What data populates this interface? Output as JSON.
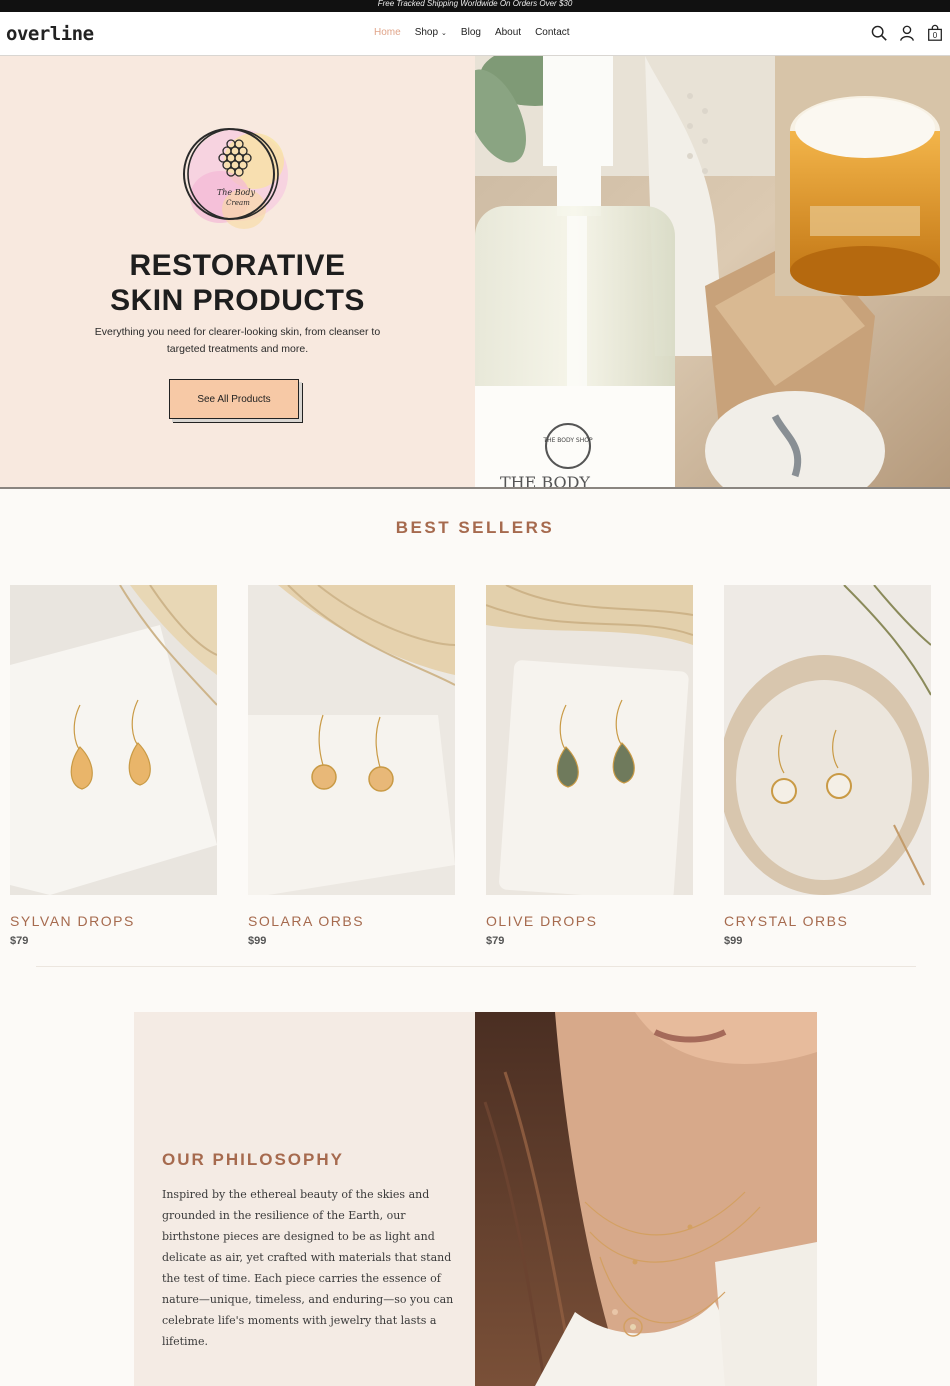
{
  "announcement": "Free Tracked Shipping Worldwide On Orders Over $30",
  "header": {
    "logo": "overline",
    "nav": [
      {
        "label": "Home",
        "active": true
      },
      {
        "label": "Shop",
        "dropdown": true
      },
      {
        "label": "Blog"
      },
      {
        "label": "About"
      },
      {
        "label": "Contact"
      }
    ],
    "icons": [
      "search-icon",
      "account-icon",
      "cart-icon"
    ],
    "cart_count": "0"
  },
  "hero": {
    "badge_text": "The Body Cream",
    "title_line1": "RESTORATIVE",
    "title_line2": "SKIN PRODUCTS",
    "subtitle": "Everything you need for clearer-looking skin, from cleanser to targeted treatments and more.",
    "button": "See All Products",
    "photo_label_brand": "THE BODY SHOP",
    "photo_label_text": "THE BODY"
  },
  "best_sellers": {
    "title": "BEST SELLERS",
    "products": [
      {
        "name": "SYLVAN DROPS",
        "price": "$79",
        "stone": "#e9b56a"
      },
      {
        "name": "SOLARA ORBS",
        "price": "$99",
        "stone": "#e8b878"
      },
      {
        "name": "OLIVE DROPS",
        "price": "$79",
        "stone": "#6f7a5c"
      },
      {
        "name": "CRYSTAL ORBS",
        "price": "$99",
        "stone": "#f4efe6"
      }
    ]
  },
  "philosophy": {
    "title": "OUR PHILOSOPHY",
    "text": "Inspired by the ethereal beauty of the skies and grounded in the resilience of the Earth, our birthstone pieces are designed to be as light and delicate as air, yet crafted with materials that stand the test of time. Each piece carries the essence of nature—unique, timeless, and enduring—so you can celebrate life's moments with jewelry that lasts a lifetime."
  },
  "colors": {
    "accent": "#a66a4e",
    "nav_active": "#e0a489",
    "hero_bg": "#f8e9df",
    "button_bg": "#f7c9a6",
    "philosophy_bg": "#f4ebe4"
  }
}
